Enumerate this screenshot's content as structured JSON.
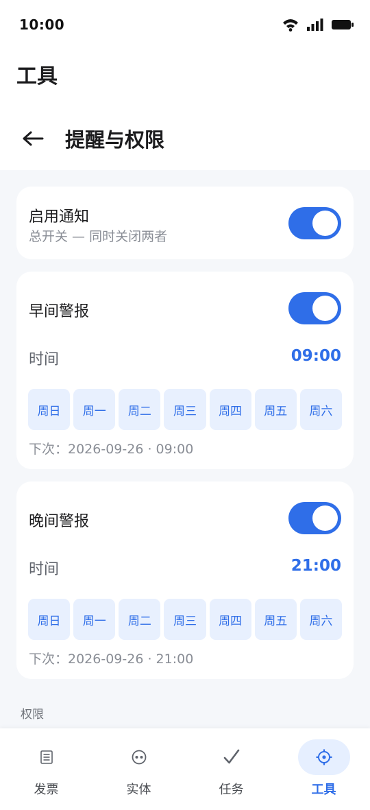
{
  "status_bar": {
    "time": "10:00",
    "icons": [
      "wifi-icon",
      "signal-icon",
      "battery-icon"
    ]
  },
  "app_title": "工具",
  "header": {
    "back_icon": "arrow-left-icon",
    "title": "提醒与权限"
  },
  "master": {
    "title": "启用通知",
    "subtitle": "总开关 — 同时关闭两者",
    "enabled": true
  },
  "alerts": [
    {
      "title": "早间警报",
      "enabled": true,
      "time_label": "时间",
      "time": "09:00",
      "days": [
        "周日",
        "周一",
        "周二",
        "周三",
        "周四",
        "周五",
        "周六"
      ],
      "next": "下次：2026-09-26 · 09:00"
    },
    {
      "title": "晚间警报",
      "enabled": true,
      "time_label": "时间",
      "time": "21:00",
      "days": [
        "周日",
        "周一",
        "周二",
        "周三",
        "周四",
        "周五",
        "周六"
      ],
      "next": "下次：2026-09-26 · 21:00"
    }
  ],
  "section_permissions": "权限",
  "bottom_nav": [
    {
      "label": "发票",
      "icon": "receipt-icon",
      "active": false
    },
    {
      "label": "实体",
      "icon": "entity-icon",
      "active": false
    },
    {
      "label": "任务",
      "icon": "check-icon",
      "active": false
    },
    {
      "label": "工具",
      "icon": "gear-icon",
      "active": true
    }
  ],
  "colors": {
    "accent": "#2f6ee8",
    "day_chip_bg": "#e8f0fe",
    "background": "#f5f7fa"
  }
}
